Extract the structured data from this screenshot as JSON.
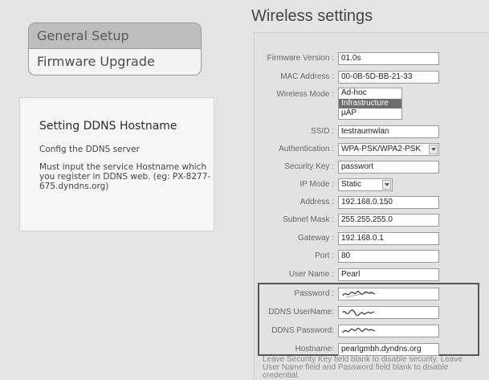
{
  "menu": {
    "items": [
      {
        "label": "General Setup"
      },
      {
        "label": "Firmware Upgrade"
      }
    ]
  },
  "help": {
    "title": "Setting DDNS Hostname",
    "lines": [
      "Config the DDNS server",
      "Must input the service Hostname which you register in DDNS web. (eg: PX-8277-675.dyndns.org)"
    ]
  },
  "page": {
    "title": "Wireless settings"
  },
  "form": {
    "firmware_version": {
      "label": "Firmware Version :",
      "value": "01.0s"
    },
    "mac_address": {
      "label": "MAC Address :",
      "value": "00-0B-5D-BB-21-33"
    },
    "wireless_mode": {
      "label": "Wireless Mode :",
      "options": [
        "Ad-hoc",
        "Infrastructure",
        "µAP"
      ],
      "selected": "Infrastructure"
    },
    "ssid": {
      "label": "SSID :",
      "value": "testraumwlan"
    },
    "authentication": {
      "label": "Authentication :",
      "value": "WPA-PSK/WPA2-PSK"
    },
    "security_key": {
      "label": "Security Key :",
      "value": "passwort"
    },
    "ip_mode": {
      "label": "IP Mode :",
      "value": "Static"
    },
    "address": {
      "label": "Address :",
      "value": "192.168.0.150"
    },
    "subnet_mask": {
      "label": "Subnet Mask :",
      "value": "255.255.255.0"
    },
    "gateway": {
      "label": "Gateway :",
      "value": "192.168.0.1"
    },
    "port": {
      "label": "Port :",
      "value": "80"
    },
    "user_name": {
      "label": "User Name :",
      "value": "Pearl"
    },
    "password": {
      "label": "Password :"
    },
    "ddns_username": {
      "label": "DDNS UserName:"
    },
    "ddns_password": {
      "label": "DDNS Password:"
    },
    "hostname": {
      "label": "Hostname:",
      "value": "pearlgmbh.dyndns.org"
    }
  },
  "notes": "Leave Security Key field blank to disable security. Leave User Name field and Password field blank to disable credential."
}
